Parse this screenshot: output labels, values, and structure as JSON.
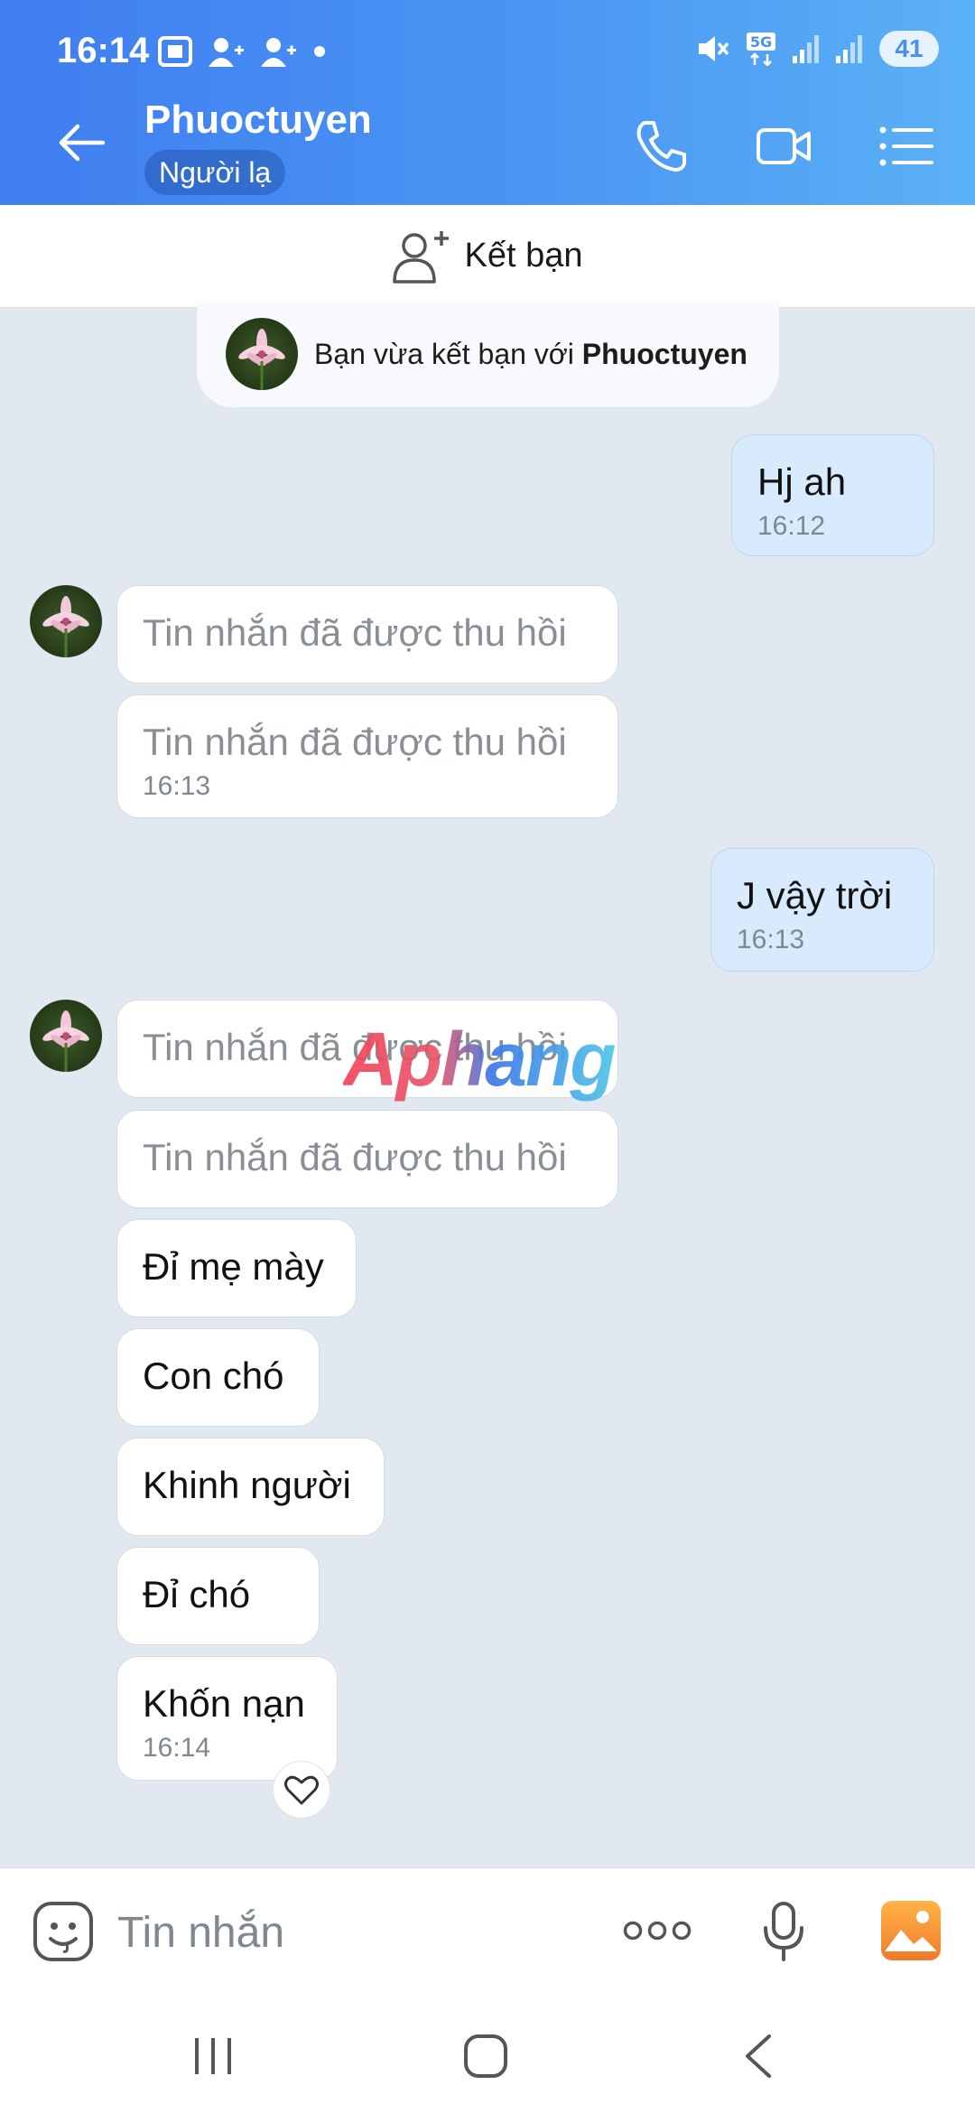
{
  "status_bar": {
    "time": "16:14",
    "network": "5G",
    "battery": "41"
  },
  "header": {
    "contact_name": "Phuoctuyen",
    "badge": "Người lạ",
    "icons": [
      "back-arrow-icon",
      "phone-icon",
      "video-call-icon",
      "menu-list-icon"
    ]
  },
  "add_friend": {
    "label": "Kết bạn",
    "icon": "add-user-icon"
  },
  "system_notice": {
    "prefix": "Bạn vừa kết bạn với ",
    "name": "Phuoctuyen"
  },
  "messages": [
    {
      "side": "out",
      "text": "Hj ah",
      "time": "16:12"
    },
    {
      "side": "in",
      "text": "Tin nhắn đã được thu hồi",
      "recalled": true
    },
    {
      "side": "in",
      "text": "Tin nhắn đã được thu hồi",
      "recalled": true,
      "time": "16:13"
    },
    {
      "side": "out",
      "text": "J vậy trời",
      "time": "16:13"
    },
    {
      "side": "in",
      "text": "Tin nhắn đã được thu hồi",
      "recalled": true
    },
    {
      "side": "in",
      "text": "Tin nhắn đã được thu hồi",
      "recalled": true
    },
    {
      "side": "in",
      "text": "Đỉ mẹ mày"
    },
    {
      "side": "in",
      "text": "Con chó"
    },
    {
      "side": "in",
      "text": "Khinh người"
    },
    {
      "side": "in",
      "text": "Đỉ chó"
    },
    {
      "side": "in",
      "text": "Khốn nạn",
      "time": "16:14"
    }
  ],
  "watermark": "Aphang",
  "input": {
    "placeholder": "Tin nhắn"
  },
  "colors": {
    "header_start": "#3f7df0",
    "header_end": "#5bb1f6",
    "outgoing_bubble": "#d7ebfd",
    "chat_bg": "#e2e8f0"
  }
}
